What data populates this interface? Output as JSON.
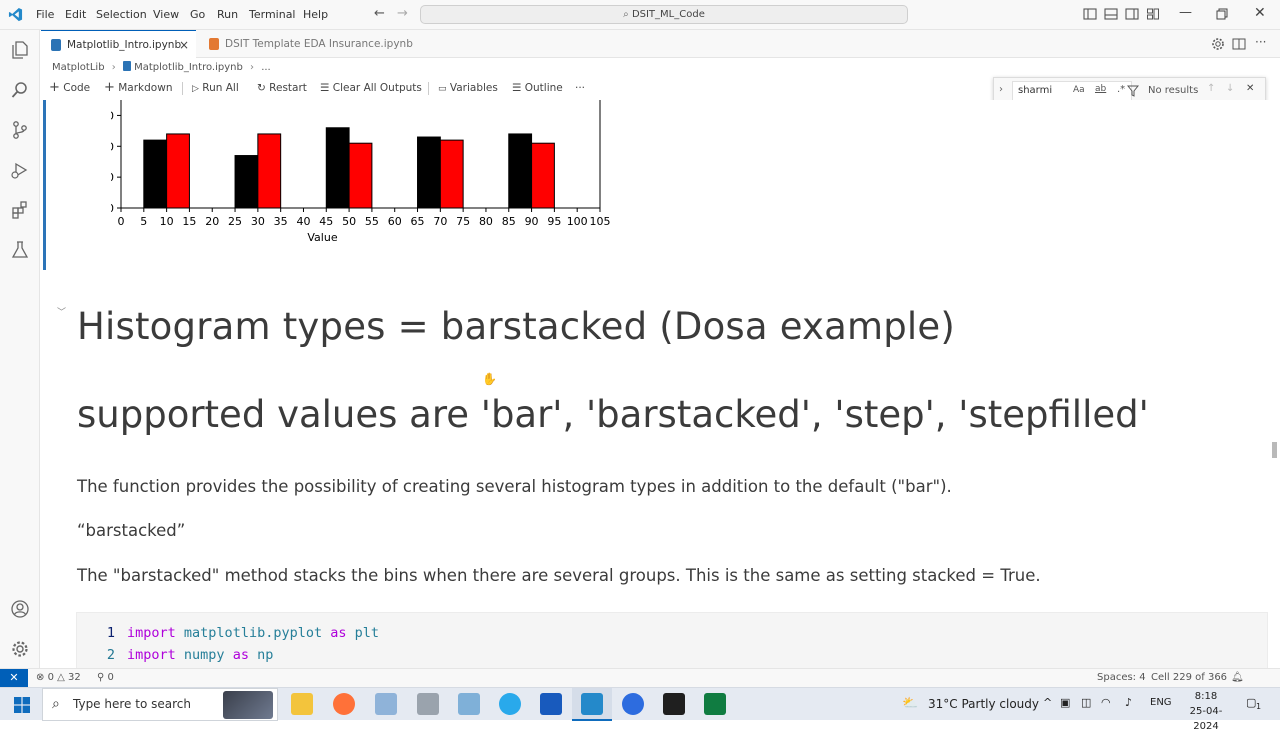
{
  "titlebar": {
    "menus": [
      "File",
      "Edit",
      "Selection",
      "View",
      "Go",
      "Run",
      "Terminal",
      "Help"
    ],
    "search_text": "DSIT_ML_Code"
  },
  "tabs": [
    {
      "label": "Matplotlib_Intro.ipynb",
      "close": "×"
    },
    {
      "label": "DSIT Template EDA Insurance.ipynb"
    }
  ],
  "breadcrumb": {
    "folder": "MatplotLib",
    "file": "Matplotlib_Intro.ipynb",
    "more": "..."
  },
  "toolbar": {
    "code": "Code",
    "markdown": "Markdown",
    "run_all": "Run All",
    "restart": "Restart",
    "clear_outputs": "Clear All Outputs",
    "variables": "Variables",
    "outline": "Outline",
    "more": "···"
  },
  "find": {
    "query": "sharmi",
    "result": "No results",
    "opt_case": "Aa",
    "opt_word": "ab",
    "opt_regex": ".*"
  },
  "chart_data": {
    "type": "bar",
    "xlabel": "Value",
    "yticks": [
      0,
      10,
      20,
      30
    ],
    "xticks": [
      0,
      5,
      10,
      15,
      20,
      25,
      30,
      35,
      40,
      45,
      50,
      55,
      60,
      65,
      70,
      75,
      80,
      85,
      90,
      95,
      100,
      105
    ],
    "ylim": [
      0,
      35
    ],
    "xlim": [
      0,
      105
    ],
    "bars": [
      {
        "x0": 5,
        "x1": 10,
        "value": 22,
        "color": "#000000"
      },
      {
        "x0": 10,
        "x1": 15,
        "value": 24,
        "color": "#ff0000"
      },
      {
        "x0": 25,
        "x1": 30,
        "value": 17,
        "color": "#000000"
      },
      {
        "x0": 30,
        "x1": 35,
        "value": 24,
        "color": "#ff0000"
      },
      {
        "x0": 45,
        "x1": 50,
        "value": 26,
        "color": "#000000"
      },
      {
        "x0": 50,
        "x1": 55,
        "value": 21,
        "color": "#ff0000"
      },
      {
        "x0": 65,
        "x1": 70,
        "value": 23,
        "color": "#000000"
      },
      {
        "x0": 70,
        "x1": 75,
        "value": 22,
        "color": "#ff0000"
      },
      {
        "x0": 85,
        "x1": 90,
        "value": 24,
        "color": "#000000"
      },
      {
        "x0": 90,
        "x1": 95,
        "value": 21,
        "color": "#ff0000"
      }
    ]
  },
  "markdown": {
    "heading1": "Histogram types = barstacked (Dosa example)",
    "heading2": "supported values are 'bar', 'barstacked', 'step', 'stepfilled'",
    "para1": "The function provides the possibility of creating several histogram types in addition to the default (\"bar\").",
    "para2": "“barstacked”",
    "para3": "The \"barstacked\" method stacks the bins when there are several groups. This is the same as setting stacked = True."
  },
  "code": {
    "lines": [
      {
        "num": "1",
        "kw": "import",
        "mod": "matplotlib.pyplot",
        "kw2": "as",
        "alias": "plt"
      },
      {
        "num": "2",
        "kw": "import",
        "mod": "numpy",
        "kw2": "as",
        "alias": "np"
      }
    ]
  },
  "status": {
    "errors": "0",
    "warnings": "32",
    "ports": "0",
    "spaces": "Spaces: 4",
    "cell": "Cell 229 of 366"
  },
  "taskbar": {
    "search_placeholder": "Type here to search",
    "weather": "31°C  Partly cloudy",
    "lang": "ENG",
    "time": "8:18",
    "date": "25-04-2024",
    "notif_count": "1"
  }
}
